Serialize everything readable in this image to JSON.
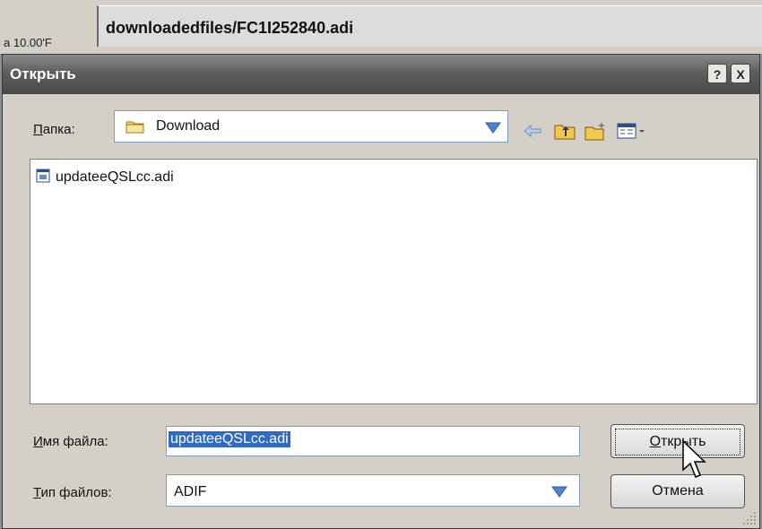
{
  "background": {
    "left_text": "а 10.00'F",
    "window_title": "downloadedfiles/FC1I252840.adi"
  },
  "dialog": {
    "title": "Открыть",
    "help_label": "?",
    "close_label": "X",
    "folder_label_underlined": "П",
    "folder_label_rest": "апка:",
    "folder_value": "Download",
    "toolbar_icons": [
      "back-arrow-icon",
      "up-folder-icon",
      "new-folder-icon",
      "view-menu-icon"
    ],
    "files": [
      {
        "name": "updateeQSLcc.adi",
        "icon": "adif-file-icon"
      }
    ],
    "filename_label_underlined": "И",
    "filename_label_rest": "мя файла:",
    "filename_value": "updateeQSLcc.adi",
    "filetype_label_underlined": "Т",
    "filetype_label_rest": "ип файлов:",
    "filetype_value": "ADIF",
    "open_button_underlined": "О",
    "open_button_rest": "ткрыть",
    "cancel_button": "Отмена"
  },
  "colors": {
    "selection": "#316ac5",
    "titlebar": "#5d5d5d",
    "dialog_bg": "#d4d0c8"
  }
}
